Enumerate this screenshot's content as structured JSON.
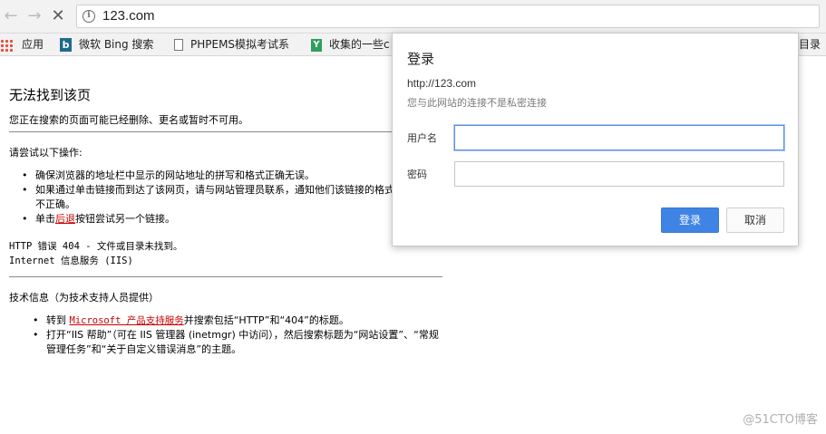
{
  "browser": {
    "url": "123.com",
    "nav": {
      "back_icon": "back-arrow-icon",
      "forward_icon": "forward-arrow-icon",
      "stop_icon": "stop-x-icon"
    },
    "bookmarks": [
      {
        "icon": "apps-grid-icon",
        "label": "应用"
      },
      {
        "icon": "bing-icon",
        "label": "微软 Bing 搜索"
      },
      {
        "icon": "page-icon",
        "label": "PHPEMS模拟考试系"
      },
      {
        "icon": "y-icon",
        "label": "收集的一些c"
      }
    ],
    "bookmarks_overflow": "目录"
  },
  "error_page": {
    "title": "无法找到该页",
    "description": "您正在搜索的页面可能已经删除、更名或暂时不可用。",
    "try_heading": "请尝试以下操作:",
    "tips": {
      "tip1": "确保浏览器的地址栏中显示的网站地址的拼写和格式正确无误。",
      "tip2": "如果通过单击链接而到达了该网页，请与网站管理员联系，通知他们该链接的格式不正确。",
      "tip3_prefix": "单击",
      "tip3_link": "后退",
      "tip3_suffix": "按钮尝试另一个链接。"
    },
    "http_error": "HTTP 错误 404 - 文件或目录未找到。",
    "iis_line": "Internet 信息服务 (IIS)",
    "tech_heading": "技术信息（为技术支持人员提供）",
    "tech": {
      "item1_prefix": "转到 ",
      "item1_link": "Microsoft 产品支持服务",
      "item1_suffix": "并搜索包括“HTTP”和“404”的标题。",
      "item2": "打开“IIS 帮助”（可在 IIS 管理器 (inetmgr) 中访问），然后搜索标题为“网站设置”、“常规管理任务”和“关于自定义错误消息”的主题。"
    }
  },
  "login_dialog": {
    "title": "登录",
    "host": "http://123.com",
    "note": "您与此网站的连接不是私密连接",
    "username_label": "用户名",
    "username_value": "",
    "password_label": "密码",
    "password_value": "",
    "login_button": "登录",
    "cancel_button": "取消",
    "accent_color": "#3f84e5"
  },
  "watermark": "@51CTO博客"
}
